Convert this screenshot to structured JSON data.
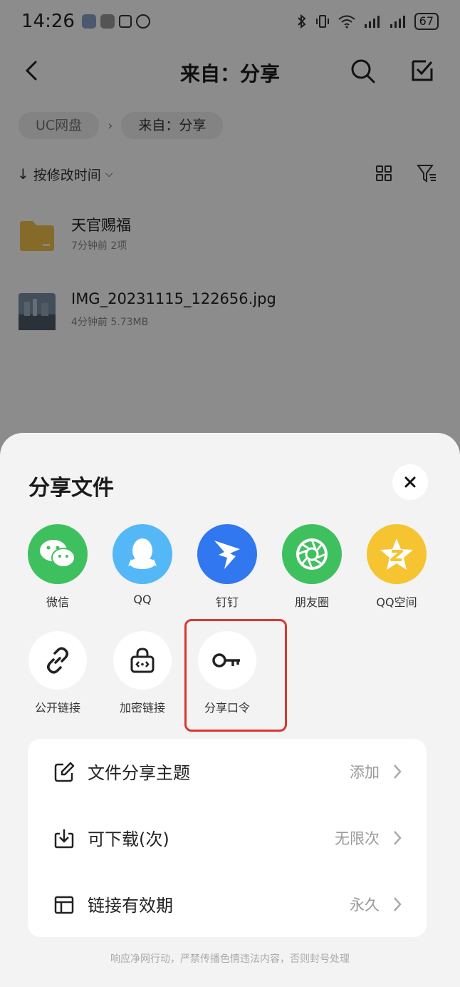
{
  "status_bar": {
    "time": "14:26",
    "battery": "67"
  },
  "header": {
    "title": "来自：分享"
  },
  "breadcrumb": {
    "items": [
      "UC网盘",
      "来自：分享"
    ],
    "separator": "›"
  },
  "sort": {
    "label": "按修改时间",
    "arrow": "↓",
    "chevron": "⌵"
  },
  "files": [
    {
      "name": "天官赐福",
      "meta": "7分钟前  2项",
      "icon": "folder-icon"
    },
    {
      "name": "IMG_20231115_122656.jpg",
      "meta": "4分钟前  5.73MB",
      "icon": "image-thumbnail"
    }
  ],
  "sheet": {
    "title": "分享文件",
    "share_targets": [
      {
        "label": "微信",
        "icon": "wechat-icon",
        "color": "#3fc05f"
      },
      {
        "label": "QQ",
        "icon": "qq-icon",
        "color": "#53b8f5"
      },
      {
        "label": "钉钉",
        "icon": "dingtalk-icon",
        "color": "#3077f0"
      },
      {
        "label": "朋友圈",
        "icon": "moments-icon",
        "color": "#3fc05f"
      },
      {
        "label": "QQ空间",
        "icon": "qzone-icon",
        "color": "#f5c430"
      }
    ],
    "tools": [
      {
        "label": "公开链接",
        "icon": "link-icon"
      },
      {
        "label": "加密链接",
        "icon": "lock-icon"
      },
      {
        "label": "分享口令",
        "icon": "key-icon"
      }
    ],
    "options": [
      {
        "label": "文件分享主题",
        "value": "添加",
        "icon": "edit-icon"
      },
      {
        "label": "可下载(次)",
        "value": "无限次",
        "icon": "download-icon"
      },
      {
        "label": "链接有效期",
        "value": "永久",
        "icon": "layout-icon"
      }
    ],
    "footer": "响应净网行动，严禁传播色情违法内容，否则封号处理"
  },
  "colors": {
    "highlight": "#d9372f",
    "overlay": "rgba(0,0,0,0.45)"
  }
}
